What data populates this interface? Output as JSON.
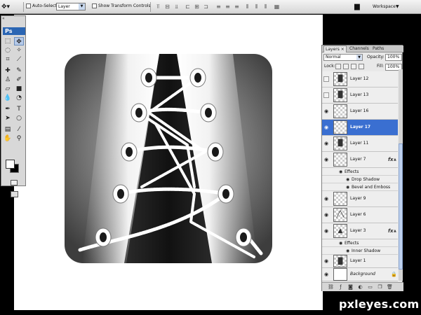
{
  "options_bar": {
    "auto_select_label": "Auto-Select:",
    "auto_select_value": "Layer",
    "show_transform_label": "Show Transform Controls",
    "workspace_label": "Workspace"
  },
  "tools": {
    "collapse_glyph": "«",
    "logo": "Ps"
  },
  "layers_panel": {
    "tabs": [
      "Layers",
      "Channels",
      "Paths"
    ],
    "tab_close": "×",
    "blend_mode": "Normal",
    "opacity_label": "Opacity:",
    "opacity_value": "100%",
    "lock_label": "Lock:",
    "fill_label": "Fill:",
    "fill_value": "100%",
    "fx_badge": "fx",
    "layers": [
      {
        "name": "Layer 12",
        "visible": false
      },
      {
        "name": "Layer 13",
        "visible": false
      },
      {
        "name": "Layer 16",
        "visible": true
      },
      {
        "name": "Layer 17",
        "visible": true,
        "selected": true
      },
      {
        "name": "Layer 11",
        "visible": true
      },
      {
        "name": "Layer 7",
        "visible": true,
        "fx": true,
        "effects_label": "Effects",
        "effects": [
          "Drop Shadow",
          "Bevel and Emboss"
        ]
      },
      {
        "name": "Layer 9",
        "visible": true
      },
      {
        "name": "Layer 6",
        "visible": true
      },
      {
        "name": "Layer 3",
        "visible": true,
        "fx": true,
        "effects_label": "Effects",
        "effects": [
          "Inner Shadow"
        ]
      },
      {
        "name": "Layer 1",
        "visible": true
      },
      {
        "name": "Background",
        "visible": true,
        "locked": true
      }
    ]
  },
  "watermark": "pxleyes.com",
  "colors": {
    "selection": "#3a6fd1",
    "ps_logo": "#2a65b3",
    "artwork_bg": "#4a4a4a",
    "tongue": "#222222",
    "lace": "#ffffff"
  }
}
